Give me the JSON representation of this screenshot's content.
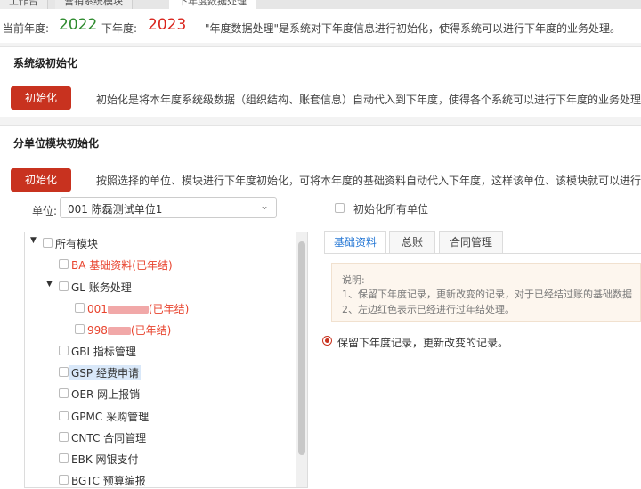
{
  "tabs": [
    "工作台",
    "营销系统模块",
    "下年度数据处理"
  ],
  "year": {
    "current_label": "当前年度:",
    "current_value": "2022",
    "next_label": "下年度:",
    "next_value": "2023",
    "description": "\"年度数据处理\"是系统对下年度信息进行初始化，使得系统可以进行下年度的业务处理。"
  },
  "system_init": {
    "title": "系统级初始化",
    "button": "初始化",
    "description": "初始化是将本年度系统级数据（组织结构、账套信息）自动代入到下年度，使得各个系统可以进行下年度的业务处理，但各"
  },
  "unit_init": {
    "title": "分单位模块初始化",
    "button": "初始化",
    "description": "按照选择的单位、模块进行下年度初始化，可将本年度的基础资料自动代入下年度，这样该单位、该模块就可以进行下年度"
  },
  "unit": {
    "label": "单位:",
    "value": "001 陈磊测试单位1",
    "init_all_label": "初始化所有单位"
  },
  "tree": {
    "root": "所有模块",
    "items": [
      {
        "label": "BA 基础资料(已年结)"
      },
      {
        "label": "GL 账务处理"
      },
      {
        "prefix": "001",
        "suffix": "(已年结)"
      },
      {
        "prefix": "998",
        "suffix": "(已年结)"
      },
      {
        "label": "GBI 指标管理"
      },
      {
        "label": "GSP 经费申请"
      },
      {
        "label": "OER 网上报销"
      },
      {
        "label": "GPMC 采购管理"
      },
      {
        "label": "CNTC 合同管理"
      },
      {
        "label": "EBK 网银支付"
      },
      {
        "label": "BGTC 预算编报"
      }
    ]
  },
  "right_tabs": [
    "基础资料",
    "总账",
    "合同管理"
  ],
  "note": {
    "title": "说明:",
    "line1": "1、保留下年度记录，更新改变的记录，对于已经结过账的基础数据",
    "line2": "2、左边红色表示已经进行过年结处理。"
  },
  "radio_label": "保留下年度记录，更新改变的记录。",
  "colors": {
    "accent": "#c8321f",
    "current_year": "#2e8b2e",
    "next_year": "#d9241c",
    "tab_active": "#2b7bd6"
  }
}
